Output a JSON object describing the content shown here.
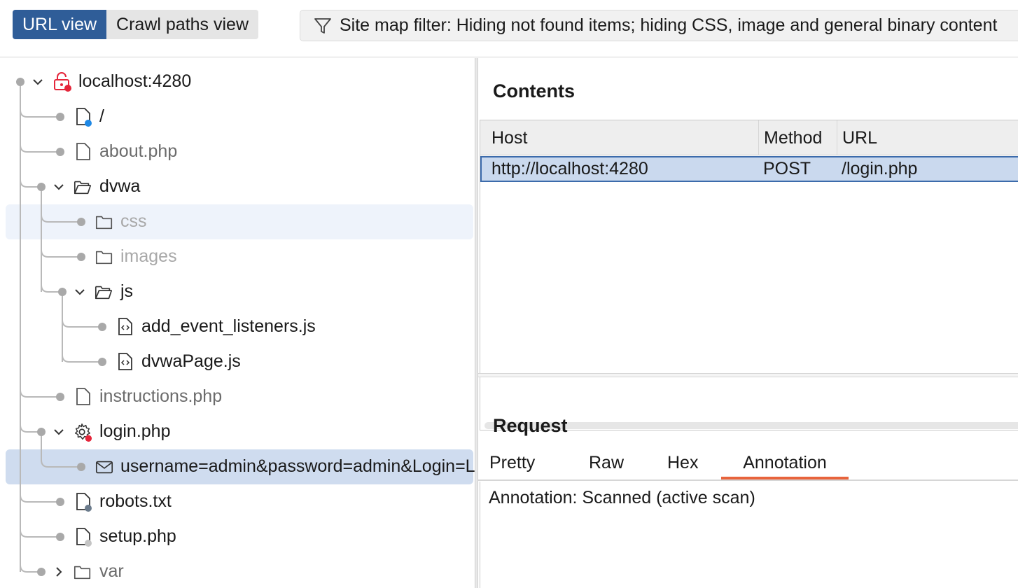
{
  "toolbar": {
    "view_toggle": {
      "url_view_label": "URL view",
      "crawl_paths_label": "Crawl paths view"
    },
    "filter": {
      "icon": "filter-icon",
      "text": "Site map filter: Hiding not found items;  hiding CSS, image and general binary content"
    }
  },
  "tree": {
    "root": {
      "label": "localhost:4280",
      "icon": "unlocked-padlock-icon",
      "badge_color": "#e5263b"
    },
    "items": {
      "slash": {
        "label": "/",
        "icon": "file-icon",
        "badge_color": "#1e88e5"
      },
      "about": {
        "label": "about.php",
        "icon": "file-icon"
      },
      "dvwa": {
        "label": "dvwa",
        "icon": "open-folder-icon"
      },
      "css": {
        "label": "css",
        "icon": "folder-icon"
      },
      "images": {
        "label": "images",
        "icon": "folder-icon"
      },
      "js": {
        "label": "js",
        "icon": "open-folder-icon"
      },
      "add_event": {
        "label": "add_event_listeners.js",
        "icon": "script-file-icon"
      },
      "dvwapage": {
        "label": "dvwaPage.js",
        "icon": "script-file-icon"
      },
      "instructions": {
        "label": "instructions.php",
        "icon": "file-icon"
      },
      "login": {
        "label": "login.php",
        "icon": "gear-icon",
        "badge_color": "#e5263b"
      },
      "login_params": {
        "label": "username=admin&password=admin&Login=Login",
        "icon": "envelope-icon"
      },
      "robots": {
        "label": "robots.txt",
        "icon": "file-icon",
        "badge_color": "#6b7b8c"
      },
      "setup": {
        "label": "setup.php",
        "icon": "file-icon",
        "badge_color": "#b0b0b0"
      },
      "var": {
        "label": "var",
        "icon": "folder-icon"
      }
    }
  },
  "contents": {
    "title": "Contents",
    "columns": {
      "host": "Host",
      "method": "Method",
      "url": "URL"
    },
    "rows": [
      {
        "host": "http://localhost:4280",
        "method": "POST",
        "url": "/login.php"
      }
    ]
  },
  "request": {
    "title": "Request",
    "tabs": {
      "pretty": "Pretty",
      "raw": "Raw",
      "hex": "Hex",
      "annotation": "Annotation"
    },
    "active_tab": "Annotation",
    "annotation_text": "Annotation: Scanned (active scan)"
  },
  "colors": {
    "accent_blue": "#2f5d98",
    "selection": "#cfdcef",
    "active_tab_underline": "#e8643c"
  }
}
